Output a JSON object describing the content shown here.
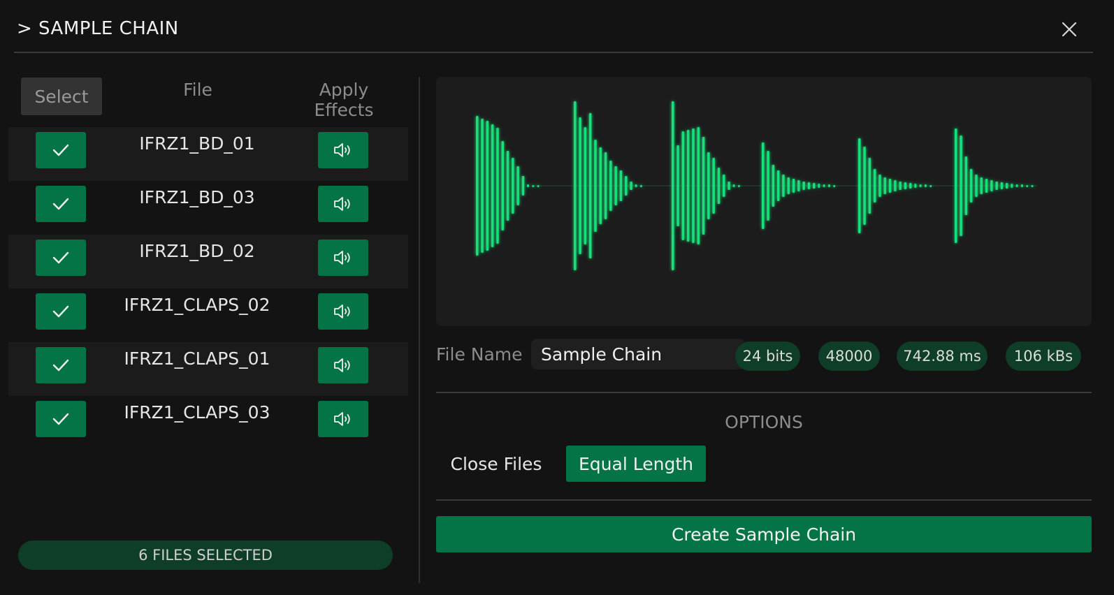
{
  "header": {
    "title": "> SAMPLE CHAIN",
    "close_icon": "close-icon"
  },
  "list": {
    "select_label": "Select",
    "file_header": "File",
    "effects_header": "Apply Effects",
    "files": [
      {
        "name": "IFRZ1_BD_01",
        "checked": true
      },
      {
        "name": "IFRZ1_BD_03",
        "checked": true
      },
      {
        "name": "IFRZ1_BD_02",
        "checked": true
      },
      {
        "name": "IFRZ1_CLAPS_02",
        "checked": true
      },
      {
        "name": "IFRZ1_CLAPS_01",
        "checked": true
      },
      {
        "name": "IFRZ1_CLAPS_03",
        "checked": true
      }
    ],
    "status": "6 FILES SELECTED"
  },
  "waveform": {
    "color": "#18e07a",
    "segments": 6
  },
  "fileinfo": {
    "label": "File Name",
    "value": "Sample Chain",
    "bits": "24 bits",
    "rate": "48000",
    "duration": "742.88 ms",
    "size": "106 kBs"
  },
  "options": {
    "label": "OPTIONS",
    "close_files": "Close Files",
    "equal_length": "Equal Length"
  },
  "create_label": "Create Sample Chain",
  "colors": {
    "accent": "#047447",
    "accent_dark": "#0f3e28",
    "wave": "#18e07a",
    "background": "#131313"
  }
}
